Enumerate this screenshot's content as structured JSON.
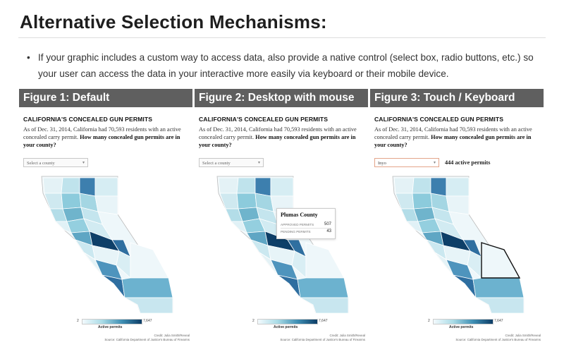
{
  "slide": {
    "title": "Alternative Selection Mechanisms:",
    "bullet": "If your graphic includes a custom way to access data, also provide a native control (select box, radio buttons, etc.) so your user can access the data in your interactive more easily via keyboard or their mobile device."
  },
  "figures": [
    {
      "label": "Figure 1: Default",
      "headline": "CALIFORNIA'S CONCEALED GUN PERMITS",
      "dek_intro": "As of Dec. 31, 2014, California had 70,593 residents with an active concealed carry permit.",
      "dek_question": "How many concealed gun permits are in your county?",
      "select_value": "Select a county",
      "legend_min": "2",
      "legend_max": "7,647",
      "legend_label": "Active permits",
      "credit": "Credit: Julia Smith/Reveal",
      "source": "Source: California Department of Justice's Bureau of Firearms"
    },
    {
      "label": "Figure 2: Desktop with mouse",
      "headline": "CALIFORNIA'S CONCEALED GUN PERMITS",
      "dek_intro": "As of Dec. 31, 2014, California had 70,593 residents with an active concealed carry permit.",
      "dek_question": "How many concealed gun permits are in your county?",
      "select_value": "Select a county",
      "tooltip": {
        "county": "Plumas County",
        "approved_label": "APPROVED PERMITS",
        "approved_value": "507",
        "pending_label": "PENDING PERMITS",
        "pending_value": "43"
      },
      "legend_min": "2",
      "legend_max": "7,647",
      "legend_label": "Active permits",
      "credit": "Credit: Julia Smith/Reveal",
      "source": "Source: California Department of Justice's Bureau of Firearms"
    },
    {
      "label": "Figure 3: Touch / Keyboard",
      "headline": "CALIFORNIA'S CONCEALED GUN PERMITS",
      "dek_intro": "As of Dec. 31, 2014, California had 70,593 residents with an active concealed carry permit.",
      "dek_question": "How many concealed gun permits are in your county?",
      "select_value": "Inyo",
      "readout": "444 active permits",
      "legend_min": "2",
      "legend_max": "7,647",
      "legend_label": "Active permits",
      "credit": "Credit: Julia Smith/Reveal",
      "source": "Source: California Department of Justice's Bureau of Firearms"
    }
  ],
  "colors": {
    "header_bg": "#5f5f5f",
    "scale_light": "#f3fafd",
    "scale_mid": "#a9dbe6",
    "scale_dark": "#0d3d66",
    "select_active_border": "#e3a58a"
  }
}
